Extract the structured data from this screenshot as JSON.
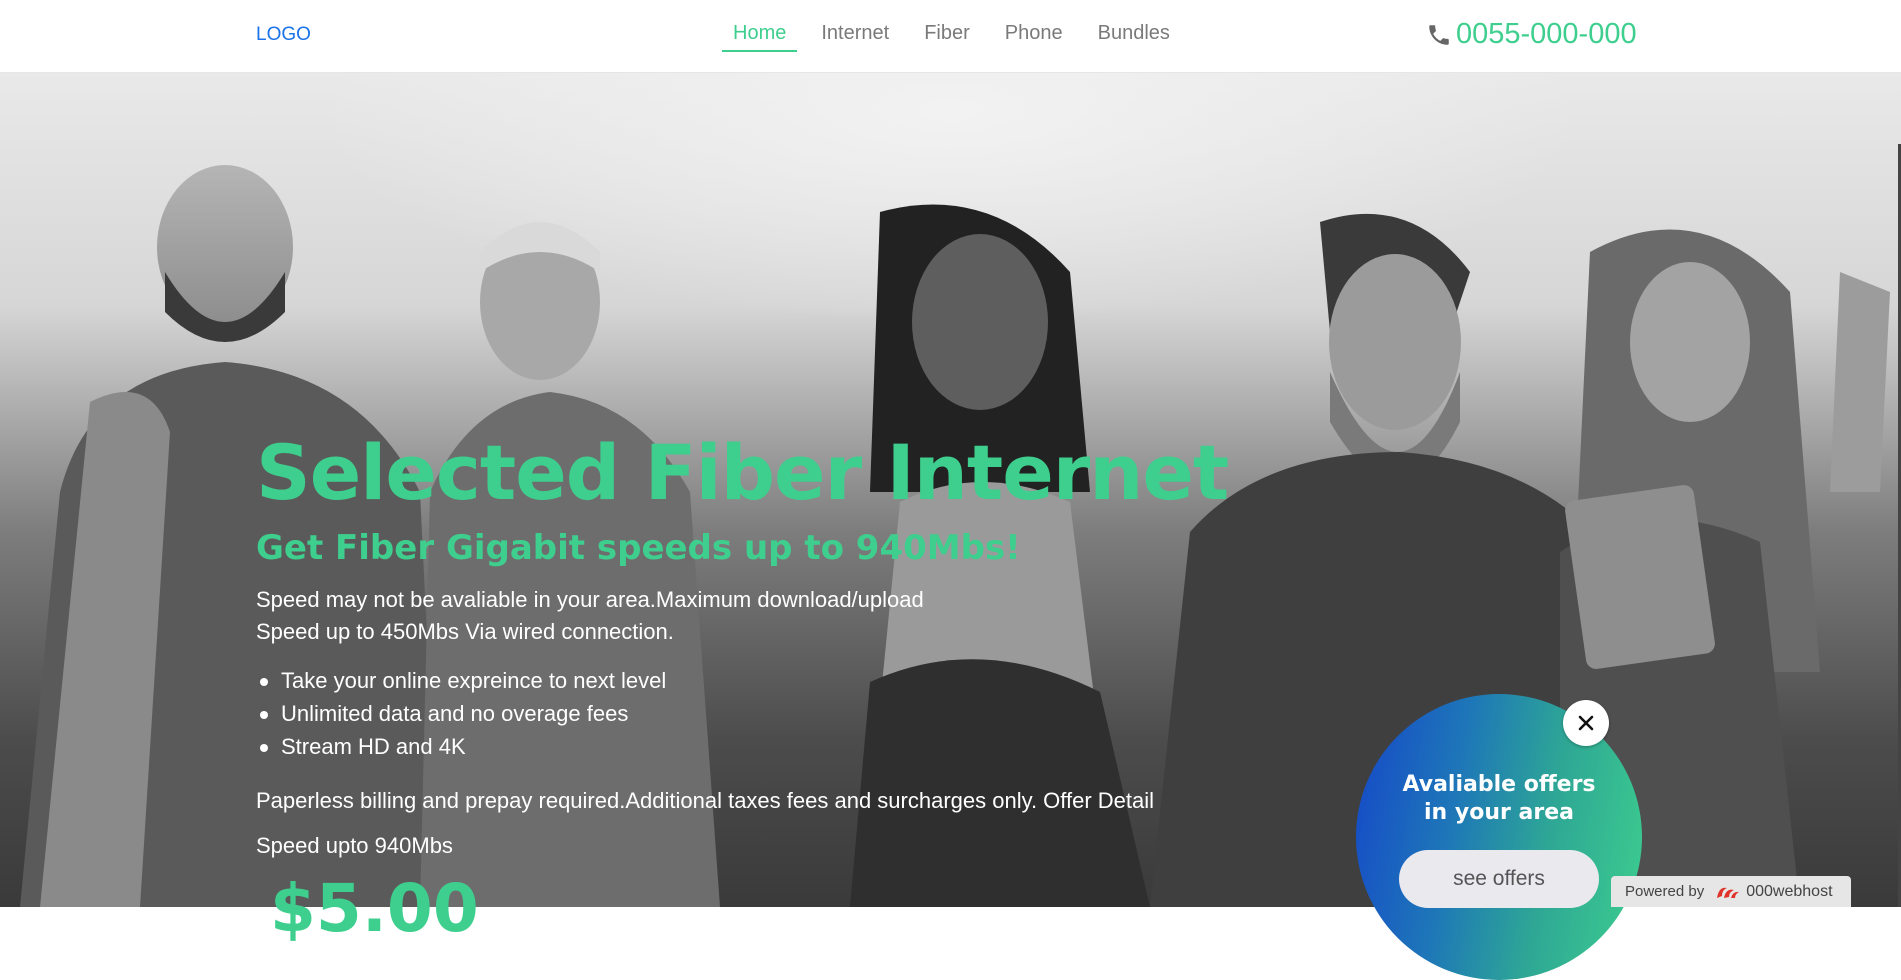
{
  "header": {
    "logo": "LOGO",
    "nav": [
      {
        "label": "Home",
        "active": true
      },
      {
        "label": "Internet",
        "active": false
      },
      {
        "label": "Fiber",
        "active": false
      },
      {
        "label": "Phone",
        "active": false
      },
      {
        "label": "Bundles",
        "active": false
      }
    ],
    "phone": "0055-000-000"
  },
  "hero": {
    "title": "Selected Fiber Internet",
    "subtitle": "Get Fiber Gigabit speeds up to 940Mbs!",
    "description_line1": "Speed may not be avaliable in your area.Maximum download/upload",
    "description_line2": "Speed up to 450Mbs Via wired connection.",
    "features": [
      "Take your online expreince to next level",
      "Unlimited data and no overage fees",
      "Stream HD and 4K"
    ],
    "fine_print": "Paperless billing and prepay required.Additional taxes fees and surcharges only. Offer Detail",
    "speed_note": "Speed upto 940Mbs",
    "price": "$5.00"
  },
  "offer_popup": {
    "title_line1": "Avaliable offers",
    "title_line2": "in your area",
    "button": "see offers",
    "close_icon": "close-icon"
  },
  "badge": {
    "powered_by": "Powered by",
    "brand": "000webhost"
  },
  "colors": {
    "accent": "#3ecf8e",
    "logo": "#1a73e8",
    "offer_gradient_start": "#1547c9",
    "offer_gradient_end": "#3ecf8e"
  }
}
